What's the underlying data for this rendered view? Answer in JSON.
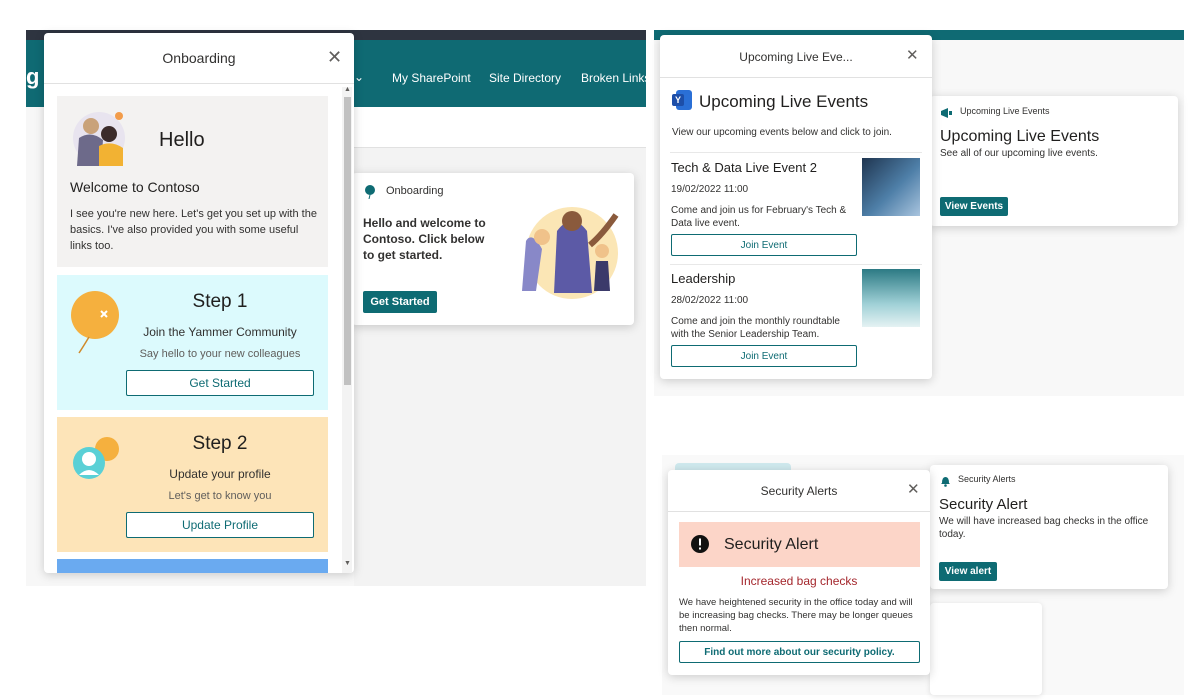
{
  "left_panel": {
    "nav_partial": "g",
    "nav": [
      "My SharePoint",
      "Site Directory",
      "Broken Links"
    ],
    "onboarding_card": {
      "title": "Onboarding",
      "text": "Hello and welcome to Contoso. Click below to get started.",
      "button": "Get Started"
    },
    "onboarding_panel": {
      "title": "Onboarding",
      "hello": "Hello",
      "welcome_heading": "Welcome to Contoso",
      "welcome_text": "I see you're new here. Let's get you set up with the basics. I've also provided you with some useful links too.",
      "steps": [
        {
          "title": "Step 1",
          "subtitle": "Join the Yammer Community",
          "desc": "Say hello to your new colleagues",
          "button": "Get Started",
          "bg": "#dcfafd"
        },
        {
          "title": "Step 2",
          "subtitle": "Update your profile",
          "desc": "Let's get to know you",
          "button": "Update Profile",
          "bg": "#fde4b8"
        }
      ]
    }
  },
  "live_events": {
    "panel_title": "Upcoming Live Eve...",
    "heading": "Upcoming Live Events",
    "intro": "View our upcoming events below and click to join.",
    "events": [
      {
        "title": "Tech & Data Live Event 2",
        "date": "19/02/2022 11:00",
        "desc": "Come and join us for February's Tech & Data live event.",
        "button": "Join Event"
      },
      {
        "title": "Leadership",
        "date": "28/02/2022 11:00",
        "desc": "Come and join the monthly roundtable with the Senior Leadership Team.",
        "button": "Join Event"
      }
    ],
    "card": {
      "label": "Upcoming Live Events",
      "heading": "Upcoming Live Events",
      "desc": "See all of our upcoming live events.",
      "button": "View Events"
    }
  },
  "security": {
    "panel_title": "Security Alerts",
    "alert_title": "Security Alert",
    "alert_subtitle": "Increased bag checks",
    "alert_text": "We have heightened security in the office today and will be increasing bag checks. There may be longer queues then normal.",
    "button": "Find out more about our security policy.",
    "card": {
      "label": "Security Alerts",
      "heading": "Security Alert",
      "desc": "We will have increased bag checks in the office today.",
      "button": "View alert"
    }
  },
  "colors": {
    "brand_teal": "#0e6b73",
    "alert_bg": "#fcd5c8",
    "alert_red": "#a4262c"
  }
}
